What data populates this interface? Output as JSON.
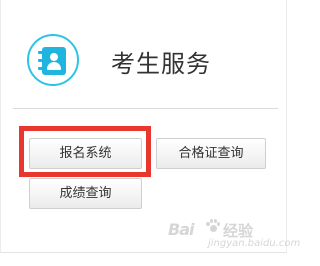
{
  "panel": {
    "title": "考生服务",
    "icon": "contact-book-icon",
    "accent_color": "#2cc4e6"
  },
  "buttons": {
    "baoming": "报名系统",
    "hege": "合格证查询",
    "chengji": "成绩查询"
  },
  "highlight": {
    "target": "报名系统",
    "color": "#e8372c"
  },
  "watermark": {
    "logo": "Bai",
    "brand": "经验",
    "url": "jingyan.baidu.com"
  }
}
